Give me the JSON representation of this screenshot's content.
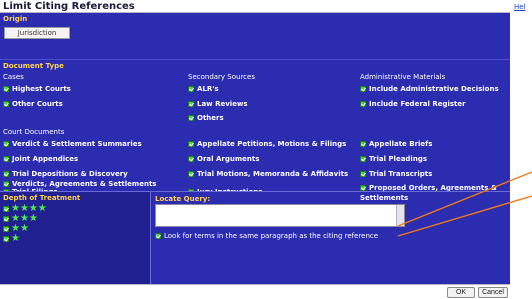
{
  "dialog": {
    "title": "Limit Citing References",
    "help_link": "Hel"
  },
  "origin": {
    "label": "Origin",
    "jurisdiction_button": "Jurisdiction"
  },
  "document_type": {
    "label": "Document Type",
    "cases": {
      "label": "Cases",
      "items": [
        "Highest Courts",
        "Other Courts"
      ]
    },
    "secondary_sources": {
      "label": "Secondary Sources",
      "items": [
        "ALR's",
        "Law Reviews",
        "Others"
      ]
    },
    "administrative_materials": {
      "label": "Administrative Materials",
      "items": [
        "Include Administrative Decisions",
        "Include Federal Register"
      ]
    },
    "court_documents": {
      "label": "Court Documents",
      "col1": [
        "Verdict & Settlement Summaries",
        "Joint Appendices",
        "Trial Depositions & Discovery",
        "Trial Filings",
        "Verdicts, Agreements & Settlements"
      ],
      "col2": [
        "Appellate Petitions, Motions & Filings",
        "Oral Arguments",
        "Trial Motions, Memoranda & Affidavits",
        "Jury Instructions"
      ],
      "col3": [
        "Appellate Briefs",
        "Trial Pleadings",
        "Trial Transcripts",
        "Proposed Orders, Agreements &",
        "Settlements"
      ]
    }
  },
  "depth_of_treatment": {
    "label": "Depth of Treatment",
    "levels": [
      {
        "stars": "★★★★",
        "count": 4
      },
      {
        "stars": "★★★",
        "count": 3
      },
      {
        "stars": "★★",
        "count": 2
      },
      {
        "stars": "★",
        "count": 1
      }
    ]
  },
  "locate": {
    "label": "Locate Query:",
    "query_value": "",
    "paragraph_option": "Look for terms in the same paragraph as the citing reference"
  },
  "footer": {
    "ok_label": "OK",
    "cancel_label": "Cancel"
  },
  "colors": {
    "panel_bg": "#2c2cb0",
    "section_label": "#ffd24a",
    "checkbox_green": "#4ad14a",
    "callout_orange": "#f07a1a"
  }
}
